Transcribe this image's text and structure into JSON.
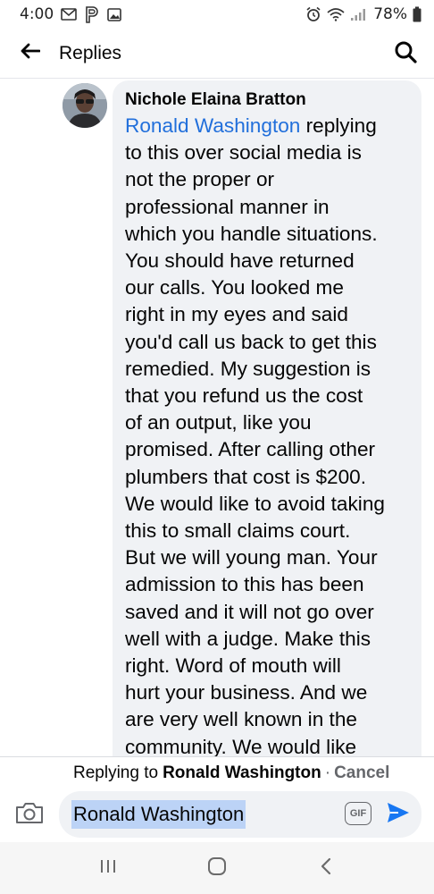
{
  "status_bar": {
    "time": "4:00",
    "battery_percent": "78%",
    "left_icons": [
      "gmail-icon",
      "parking-icon",
      "gallery-icon"
    ],
    "right_icons": [
      "alarm-icon",
      "wifi-icon",
      "signal-icon",
      "battery-icon"
    ]
  },
  "header": {
    "title": "Replies",
    "back_icon": "arrow-left-icon",
    "search_icon": "search-icon"
  },
  "comment": {
    "author": "Nichole Elaina Bratton",
    "mention": "Ronald Washington",
    "lines": [
      " replying",
      "to this over social media is",
      "not the proper or",
      "professional manner in",
      "which you handle situations.",
      "You should have returned",
      "our calls. You looked me",
      "right in my eyes and said",
      "you'd call us back to get this",
      "remedied. My suggestion is",
      "that you refund us the cost",
      "of an output, like you",
      "promised. After calling other",
      "plumbers that cost is $200.",
      "We would like to avoid taking",
      "this to small claims court.",
      "But we will young man. Your",
      "admission to this has been",
      "saved and it will not go over",
      "well with a judge. Make this",
      "right. Word of mouth will",
      "hurt your business. And we",
      "are very well known in the",
      "community. We would like"
    ]
  },
  "replying_bar": {
    "prefix": "Replying to",
    "name": "Ronald Washington",
    "separator": "·",
    "cancel": "Cancel"
  },
  "composer": {
    "value": "Ronald Washington",
    "gif_label": "GIF",
    "camera_icon": "camera-icon",
    "send_icon": "send-icon"
  },
  "colors": {
    "mention": "#216fdb",
    "send": "#1877f2",
    "bubble": "#f0f2f5",
    "selection": "#bcd3f6"
  },
  "nav_bar": {
    "icons": [
      "recent-apps-icon",
      "home-icon",
      "back-icon"
    ]
  }
}
